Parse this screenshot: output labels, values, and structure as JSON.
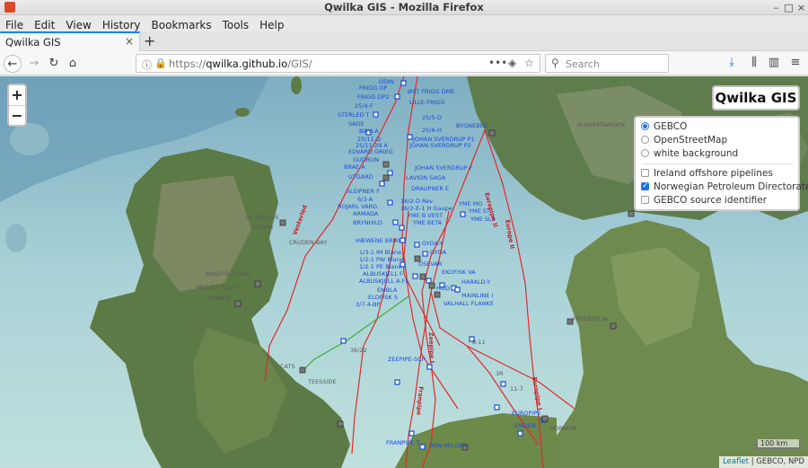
{
  "window": {
    "title": "Qwilka GIS - Mozilla Firefox"
  },
  "menu": [
    "File",
    "Edit",
    "View",
    "History",
    "Bookmarks",
    "Tools",
    "Help"
  ],
  "tab": {
    "label": "Qwilka GIS",
    "close": "×",
    "new": "+"
  },
  "nav": {
    "url_scheme": "https://",
    "url_host": "qwilka.github.io",
    "url_path": "/GIS/",
    "search_placeholder": "Search"
  },
  "map": {
    "brand": "Qwilka GIS",
    "zoom_in": "+",
    "zoom_out": "−",
    "layers": {
      "base": [
        {
          "label": "GEBCO",
          "selected": true
        },
        {
          "label": "OpenStreetMap",
          "selected": false
        },
        {
          "label": "white background",
          "selected": false
        }
      ],
      "overlays": [
        {
          "label": "Ireland offshore pipelines",
          "checked": false
        },
        {
          "label": "Norwegian Petroleum Directorate",
          "checked": true
        },
        {
          "label": "GEBCO source identifier",
          "checked": false
        }
      ]
    },
    "scale": "100 km",
    "attribution": {
      "leaflet": "Leaflet",
      "rest": " | GEBCO, NPD"
    },
    "labels_blue": [
      "FRIGG OP",
      "FRIGG DP2",
      "25/4-F",
      "STERLED T",
      "SAGE",
      "BØYLA",
      "25/11-D",
      "25/11-29 A",
      "EDVARD GRIEG",
      "GUDRUN",
      "BRAE A",
      "UTGARD",
      "SLEIPNER F",
      "6/3-A",
      "ROJARL VARG",
      "ARMADA",
      "BRYNHILD",
      "HÆWENE BRIM",
      "GYDA-Y",
      "GYDA",
      "1/3-1 IM Blane",
      "1/2-1 PW Blane",
      "1/2-1 PE Blane",
      "ALBUSKJELL F",
      "ALBUSKJELL A-FL",
      "EMBLA",
      "ELDFISK S",
      "3/7-4-BP",
      "ZEEPIPE-SCP",
      "FRANPIPE T",
      "DEN HELDER",
      "EUROPIPE",
      "EMDEN",
      "JOHAN SVERDRUP P1",
      "JOHAN SVERDRUP P2",
      "JOHAN SVERDRUP F",
      "LAVION SAGA",
      "DRAUPNER E",
      "16/2-D Rev",
      "16/2-E-1 H Gaupe",
      "YME B VEST",
      "YME BETA",
      "YME MO",
      "YME ST",
      "YME SLS",
      "EKOFISK VA",
      "HARALD-Y",
      "VALHALL FLANKE",
      "MAINLINE I",
      "HOD",
      "OSEVAR",
      "25/5-D",
      "25/6-H",
      "ØST FRIGG DME",
      "BYGNEBES",
      "ODIN",
      "LILLE-FRIGG"
    ],
    "labels_grey": [
      "ST FERGUS",
      "DALAM",
      "CRUDEN BAY",
      "BRAEFOOT BAY",
      "MOUNT POINT",
      "TEESSIDE",
      "CATS",
      "SLAGENTANGEN",
      "DORNUM",
      "FREDERICIA",
      "KINNEIL"
    ],
    "labels_red": [
      "Vesterled",
      "Europipe II",
      "Zeepipe I",
      "Franpipe",
      "Europipe I",
      "Europe II"
    ],
    "labels_other": [
      "8-11",
      "36/22",
      "3R",
      "11-7"
    ]
  }
}
